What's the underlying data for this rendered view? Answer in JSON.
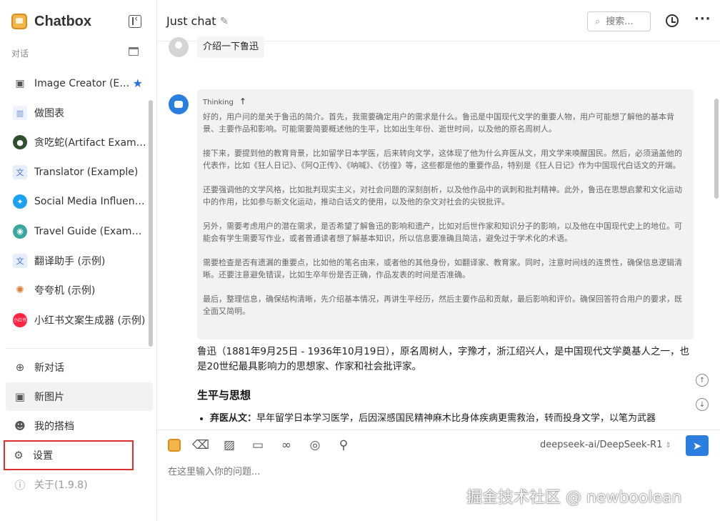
{
  "app": {
    "name": "Chatbox"
  },
  "sidebar": {
    "section_label": "对话",
    "sessions": [
      {
        "label": "Image Creator (Example)",
        "icon": "image-icon",
        "color": "#555555",
        "starred": true
      },
      {
        "label": "做图表",
        "icon": "chart-icon",
        "color": "#6a8fd8"
      },
      {
        "label": "贪吃蛇(Artifact Example)",
        "icon": "snake-icon",
        "color": "#2f4f2f"
      },
      {
        "label": "Translator (Example)",
        "icon": "translate-icon",
        "color": "#4a78c9"
      },
      {
        "label": "Social Media Influencer (Example)",
        "icon": "twitter-icon",
        "color": "#1da1f2"
      },
      {
        "label": "Travel Guide (Example)",
        "icon": "globe-icon",
        "color": "#3aa6a0"
      },
      {
        "label": "翻译助手 (示例)",
        "icon": "translate-icon",
        "color": "#4a78c9"
      },
      {
        "label": "夸夸机 (示例)",
        "icon": "sparkle-icon",
        "color": "#e07b39"
      },
      {
        "label": "小红书文案生成器 (示例)",
        "icon": "xiaohongshu-icon",
        "color": "#ff2442",
        "badge": "小红书"
      }
    ],
    "nav": {
      "new_chat": "新对话",
      "new_image": "新图片",
      "my_partners": "我的搭档",
      "settings": "设置",
      "about": "关于(1.9.8)"
    }
  },
  "header": {
    "title": "Just chat",
    "search_placeholder": "搜索..."
  },
  "messages": {
    "user": "介绍一下鲁迅",
    "thinking_label": "Thinking",
    "thinking": [
      "好的，用户问的是关于鲁迅的简介。首先，我需要确定用户的需求是什么。鲁迅是中国现代文学的重要人物，用户可能想了解他的基本背景、主要作品和影响。可能需要简要概述他的生平，比如出生年份、逝世时间，以及他的原名周树人。",
      "接下来，要提到他的教育背景，比如留学日本学医，后来转向文学，这体现了他为什么弃医从文，用文学来唤醒国民。然后，必须涵盖他的代表作，比如《狂人日记》、《阿Q正传》、《呐喊》、《彷徨》等，这些都是他的重要作品，特别是《狂人日记》作为中国现代白话文的开端。",
      "还要强调他的文学风格，比如批判现实主义，对社会问题的深刻剖析，以及他作品中的讽刺和批判精神。此外，鲁迅在思想启蒙和文化运动中的作用，比如参与新文化运动，推动白话文的使用，以及他的杂文对社会的尖锐批评。",
      "另外，需要考虑用户的潜在需求，是否希望了解鲁迅的影响和遗产，比如对后世作家和知识分子的影响，以及他在中国现代史上的地位。可能会有学生需要写作业，或者普通读者想了解基本知识，所以信息要准确且简洁，避免过于学术化的术语。",
      "需要检查是否有遗漏的重要点，比如他的笔名由来，或者他的其他身份，如翻译家、教育家。同时，注意时间线的连贯性，确保信息逻辑清晰。还要注意避免错误，比如生卒年份是否正确，作品发表的时间是否准确。",
      "最后，整理信息，确保结构清晰，先介绍基本情况，再讲生平经历，然后主要作品和贡献，最后影响和评价。确保回答符合用户的要求，既全面又简明。"
    ],
    "answer_intro": "鲁迅（1881年9月25日 - 1936年10月19日），原名周树人，字豫才，浙江绍兴人，是中国现代文学奠基人之一，也是20世纪最具影响力的思想家、作家和社会批评家。",
    "answer_heading": "生平与思想",
    "answer_bullet_title": "弃医从文：",
    "answer_bullet_text": "早年留学日本学习医学，后因深感国民精神麻木比身体疾病更需救治，转而投身文学，以笔为武器"
  },
  "composer": {
    "model": "deepseek-ai/DeepSeek-R1",
    "placeholder": "在这里输入你的问题..."
  },
  "watermark": "掘金技术社区 @ newboolean",
  "colors": {
    "accent": "#2a7ee0",
    "highlight_border": "#d9312b",
    "star": "#2b6fde"
  }
}
